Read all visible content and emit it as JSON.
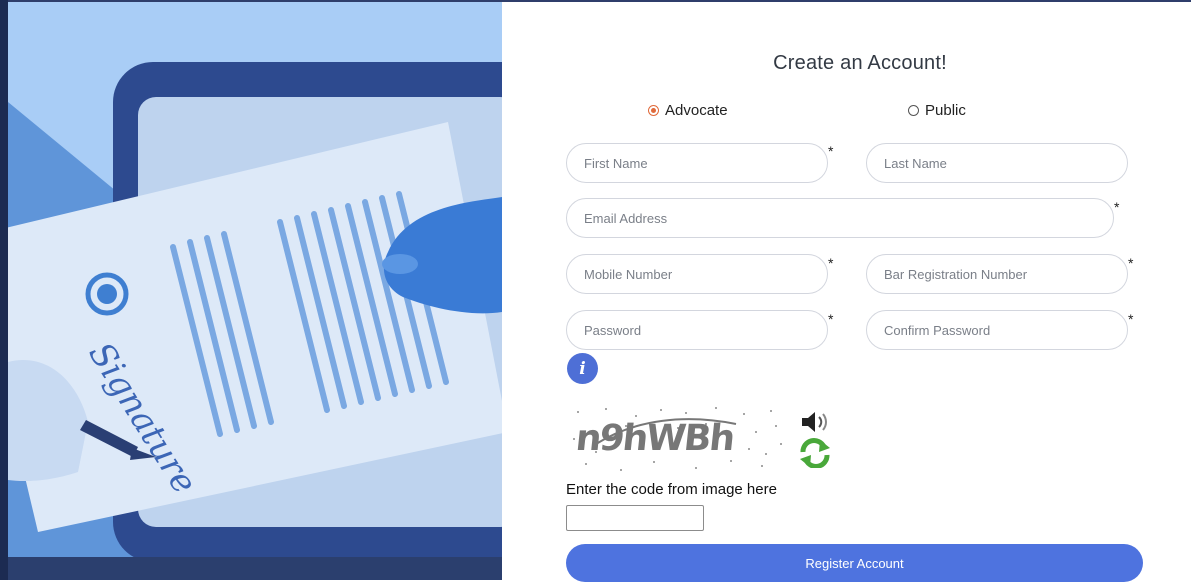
{
  "form": {
    "title": "Create an Account!",
    "account_type": {
      "options": [
        {
          "label": "Advocate",
          "selected": true
        },
        {
          "label": "Public",
          "selected": false
        }
      ]
    },
    "fields": {
      "first_name": {
        "placeholder": "First Name",
        "required": true
      },
      "last_name": {
        "placeholder": "Last Name",
        "required": false
      },
      "email": {
        "placeholder": "Email Address",
        "required": true
      },
      "mobile": {
        "placeholder": "Mobile Number",
        "required": true
      },
      "bar_registration": {
        "placeholder": "Bar Registration Number",
        "required": true
      },
      "password": {
        "placeholder": "Password",
        "required": true
      },
      "confirm_password": {
        "placeholder": "Confirm Password",
        "required": true
      }
    },
    "required_marker": "*",
    "info_icon": "i",
    "captcha": {
      "image_text": "n9hWBh",
      "label": "Enter the code from image here",
      "value": "",
      "audio_icon": "speaker-icon",
      "refresh_icon": "refresh-icon"
    },
    "submit_label": "Register Account"
  },
  "illustration": {
    "caption_text": "Signature"
  },
  "colors": {
    "primary": "#4e73df",
    "radio_accent": "#e06a3b",
    "illustration_bg": "#a9cdf6",
    "info_icon": "#4e6fd6"
  }
}
